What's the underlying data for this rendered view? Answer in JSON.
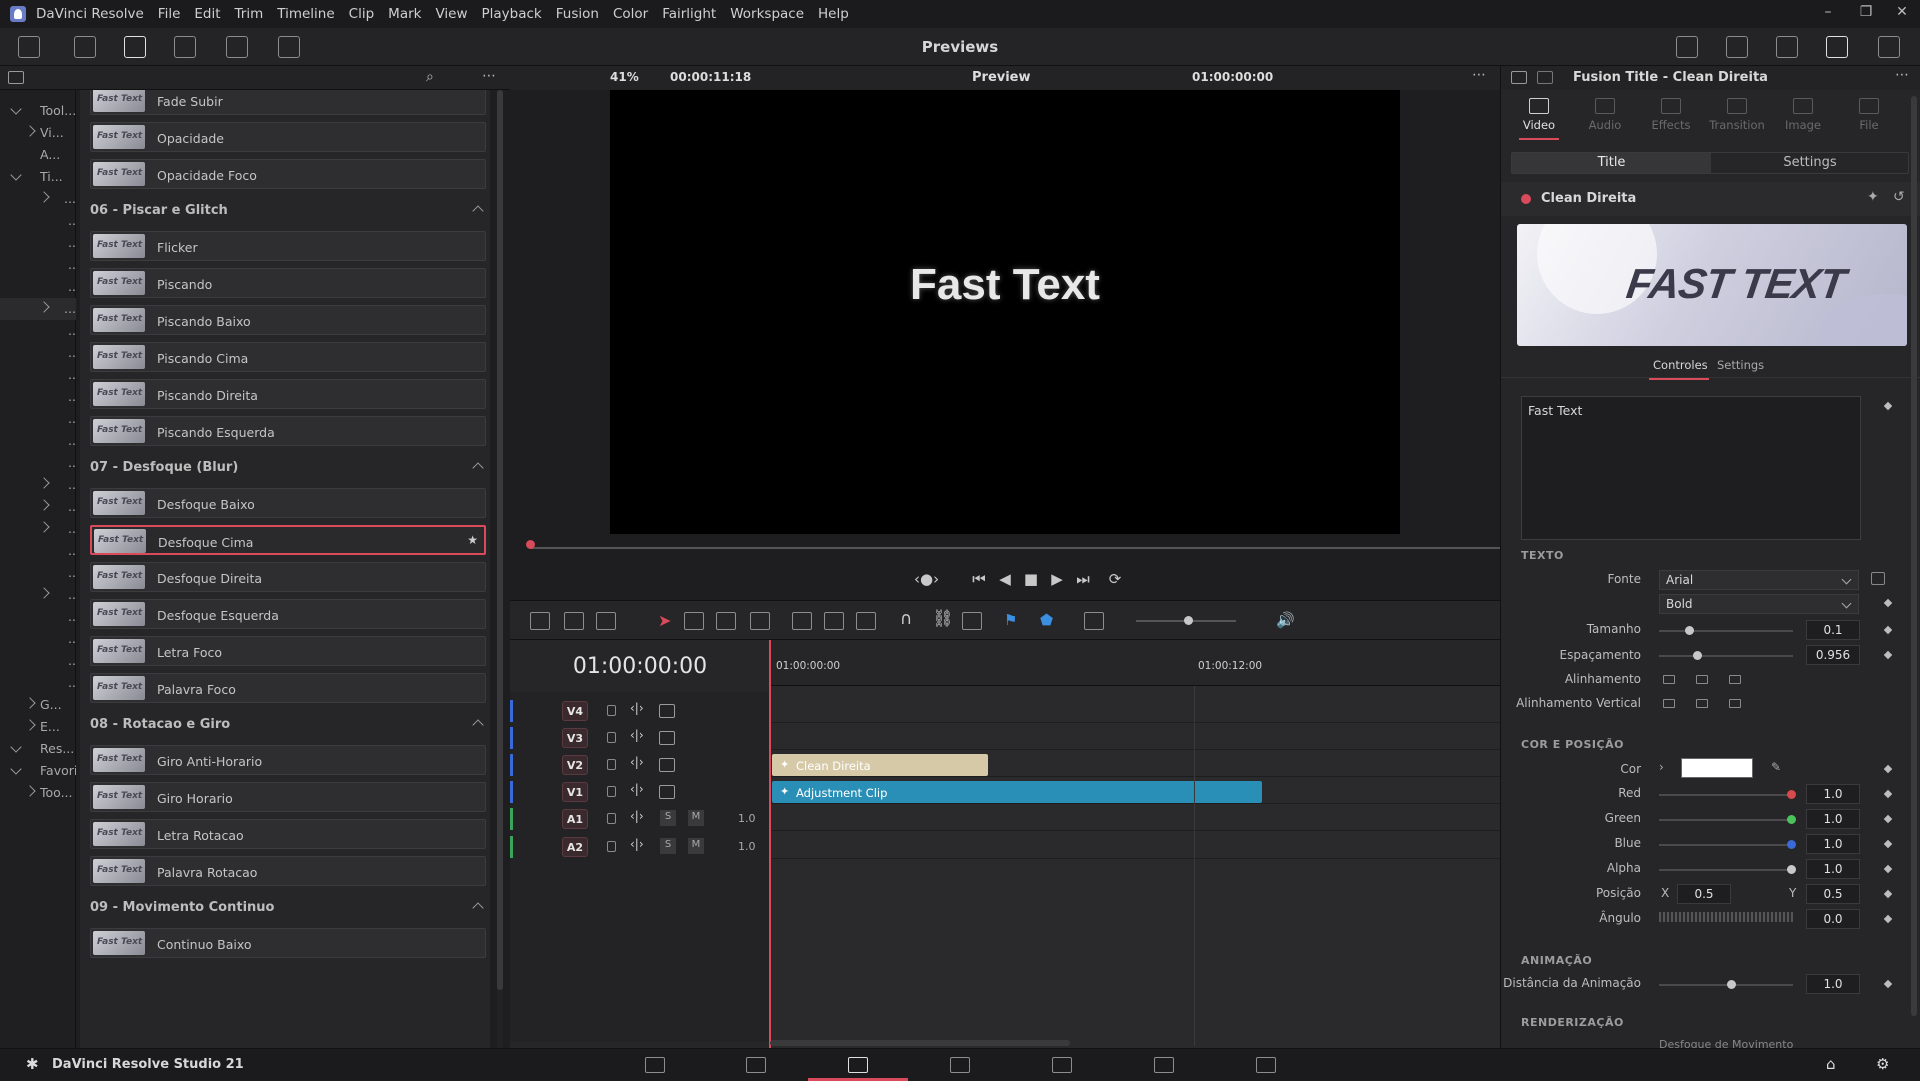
{
  "app": {
    "name": "DaVinci Resolve",
    "menus": [
      "File",
      "Edit",
      "Trim",
      "Timeline",
      "Clip",
      "Mark",
      "View",
      "Playback",
      "Fusion",
      "Color",
      "Fairlight",
      "Workspace",
      "Help"
    ],
    "footer_name": "DaVinci Resolve Studio 21"
  },
  "toolbar": {
    "title": "Previews"
  },
  "left_tree": {
    "rows": [
      {
        "label": "Tool...",
        "state": "down"
      },
      {
        "label": "Vi...",
        "state": "right"
      },
      {
        "label": "A...",
        "state": "none"
      },
      {
        "label": "Ti...",
        "state": "down"
      },
      {
        "label": "...",
        "state": "right"
      },
      {
        "label": "...",
        "state": "none"
      },
      {
        "label": "...",
        "state": "none"
      },
      {
        "label": "...",
        "state": "none"
      },
      {
        "label": "...",
        "state": "none"
      },
      {
        "label": "...",
        "state": "right"
      },
      {
        "label": "...",
        "state": "none"
      },
      {
        "label": "...",
        "state": "none"
      },
      {
        "label": "...",
        "state": "none"
      },
      {
        "label": "...",
        "state": "none"
      },
      {
        "label": "...",
        "state": "none"
      },
      {
        "label": "...",
        "state": "none"
      },
      {
        "label": "...",
        "state": "none"
      },
      {
        "label": "...",
        "state": "right"
      },
      {
        "label": "...",
        "state": "right"
      },
      {
        "label": "...",
        "state": "right"
      },
      {
        "label": "...",
        "state": "none"
      },
      {
        "label": "...",
        "state": "none"
      },
      {
        "label": "...",
        "state": "right"
      },
      {
        "label": "...",
        "state": "none"
      },
      {
        "label": "...",
        "state": "none"
      },
      {
        "label": "...",
        "state": "none"
      },
      {
        "label": "...",
        "state": "none"
      },
      {
        "label": "G...",
        "state": "right"
      },
      {
        "label": "E...",
        "state": "right"
      },
      {
        "label": "Res...",
        "state": "down"
      },
      {
        "label": "Favori...",
        "state": "down"
      },
      {
        "label": "Too...",
        "state": "right"
      }
    ]
  },
  "fx_list": {
    "thumb_label": "Fast Text",
    "groups": [
      {
        "title": "",
        "items": [
          "Fade Subir",
          "Opacidade",
          "Opacidade Foco"
        ]
      },
      {
        "title": "06 - Piscar e Glitch",
        "items": [
          "Flicker",
          "Piscando",
          "Piscando Baixo",
          "Piscando Cima",
          "Piscando Direita",
          "Piscando Esquerda"
        ]
      },
      {
        "title": "07 - Desfoque (Blur)",
        "items": [
          "Desfoque Baixo",
          "Desfoque Cima",
          "Desfoque Direita",
          "Desfoque Esquerda",
          "Letra Foco",
          "Palavra Foco"
        ]
      },
      {
        "title": "08 - Rotacao e Giro",
        "items": [
          "Giro Anti-Horario",
          "Giro Horario",
          "Letra Rotacao",
          "Palavra Rotacao"
        ]
      },
      {
        "title": "09 - Movimento Continuo",
        "items": [
          "Continuo Baixo"
        ]
      }
    ],
    "selected": "Desfoque Cima"
  },
  "viewer": {
    "zoom": "41%",
    "timecode_left": "00:00:11:18",
    "mode": "Preview",
    "timecode_right": "01:00:00:00",
    "canvas_text": "Fast Text"
  },
  "timeline": {
    "timecode": "01:00:00:00",
    "ruler": [
      "01:00:00:00",
      "01:00:12:00"
    ],
    "tracks": [
      {
        "id": "V4",
        "type": "video"
      },
      {
        "id": "V3",
        "type": "video"
      },
      {
        "id": "V2",
        "type": "video"
      },
      {
        "id": "V1",
        "type": "video"
      },
      {
        "id": "A1",
        "type": "audio",
        "vol": "1.0"
      },
      {
        "id": "A2",
        "type": "audio",
        "vol": "1.0"
      }
    ],
    "clips": [
      {
        "label": "Clean Direita",
        "track": "V2",
        "color": "#d6c9a8"
      },
      {
        "label": "Adjustment Clip",
        "track": "V1",
        "color": "#2a8fb6"
      }
    ],
    "solo_label": "S",
    "mute_label": "M"
  },
  "inspector": {
    "title": "Fusion Title - Clean Direita",
    "tabs": [
      "Video",
      "Audio",
      "Effects",
      "Transition",
      "Image",
      "File"
    ],
    "active_tab": "Video",
    "segments": [
      "Title",
      "Settings"
    ],
    "clip_name": "Clean Direita",
    "thumb_text": "FAST TEXT",
    "sub_tabs": [
      "Controles",
      "Settings"
    ],
    "text_value": "Fast Text",
    "section_text": "TEXTO",
    "fonte_label": "Fonte",
    "font": "Arial",
    "font_style": "Bold",
    "tamanho_label": "Tamanho",
    "tamanho": "0.1",
    "espacamento_label": "Espaçamento",
    "espacamento": "0.956",
    "alinhamento_label": "Alinhamento",
    "alinhamento_v_label": "Alinhamento Vertical",
    "section_color": "COR E POSIÇÃO",
    "cor_label": "Cor",
    "red_label": "Red",
    "red": "1.0",
    "green_label": "Green",
    "green": "1.0",
    "blue_label": "Blue",
    "blue": "1.0",
    "alpha_label": "Alpha",
    "alpha": "1.0",
    "posicao_label": "Posição",
    "pos_x_label": "X",
    "pos_x": "0.5",
    "pos_y_label": "Y",
    "pos_y": "0.5",
    "angulo_label": "Ângulo",
    "angulo": "0.0",
    "section_anim": "ANIMAÇÃO",
    "distancia_label": "Distância da Animação",
    "distancia": "1.0",
    "section_render": "RENDERIZAÇÃO",
    "render_item": "Desfoque de Movimento"
  },
  "colors": {
    "accent": "#d94a5a",
    "clip_title": "#d6c9a8",
    "clip_adjust": "#2a8fb6"
  }
}
